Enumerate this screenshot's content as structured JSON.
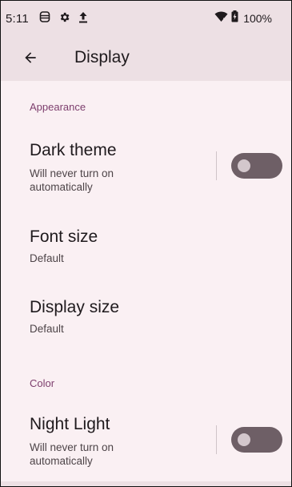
{
  "status_bar": {
    "time": "5:11",
    "icons_left": [
      "vpn-icon",
      "settings-gear-icon",
      "upload-icon"
    ],
    "icons_right": [
      "wifi-icon",
      "battery-icon"
    ],
    "battery_text": "100%"
  },
  "app_bar": {
    "back_icon": "arrow-back-icon",
    "title": "Display"
  },
  "sections": {
    "appearance": {
      "header": "Appearance",
      "dark_theme": {
        "title": "Dark theme",
        "summary": "Will never turn on automatically",
        "enabled": false
      },
      "font_size": {
        "title": "Font size",
        "summary": "Default"
      },
      "display_size": {
        "title": "Display size",
        "summary": "Default"
      }
    },
    "color": {
      "header": "Color",
      "night_light": {
        "title": "Night Light",
        "summary": "Will never turn on automatically",
        "enabled": false
      }
    }
  },
  "colors": {
    "app_bar_bg": "#ede0e4",
    "page_bg": "#faf0f3",
    "section_header": "#7d3e6d",
    "toggle_track_off": "#6e5f66",
    "toggle_thumb_off": "#d3c7cc"
  }
}
